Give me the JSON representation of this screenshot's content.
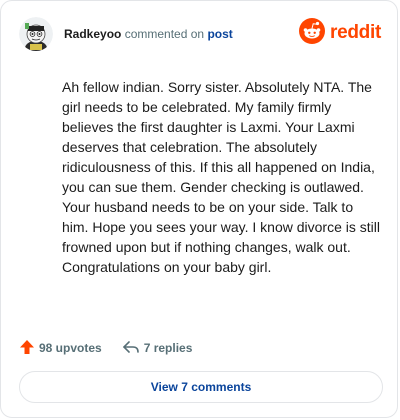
{
  "comment": {
    "username": "Radkeyoo",
    "action_text": "commented on",
    "post_link": "post",
    "body": "Ah fellow indian. Sorry sister. Absolutely NTA. The girl needs to be celebrated. My family firmly believes the first daughter is Laxmi. Your Laxmi deserves that celebration. The absolutely ridiculousness of this. If this all happened on India, you can sue them. Gender checking is outlawed. Your husband needs to be on your side. Talk to him. Hope you sees your way. I know divorce is still frowned upon but if nothing changes, walk out. Congratulations on your baby girl.",
    "upvotes": "98 upvotes",
    "replies": "7 replies"
  },
  "brand": {
    "name": "reddit",
    "icon": "reddit-logo-icon",
    "color": "#ff4500"
  },
  "icons": {
    "avatar": "avatar",
    "upvote": "upvote-arrow-icon",
    "reply": "reply-arrow-icon"
  },
  "footer": {
    "view_comments_label": "View 7 comments"
  },
  "colors": {
    "accent_link": "#0a449b",
    "meta_gray": "#576f76",
    "upvote": "#ff4500"
  }
}
